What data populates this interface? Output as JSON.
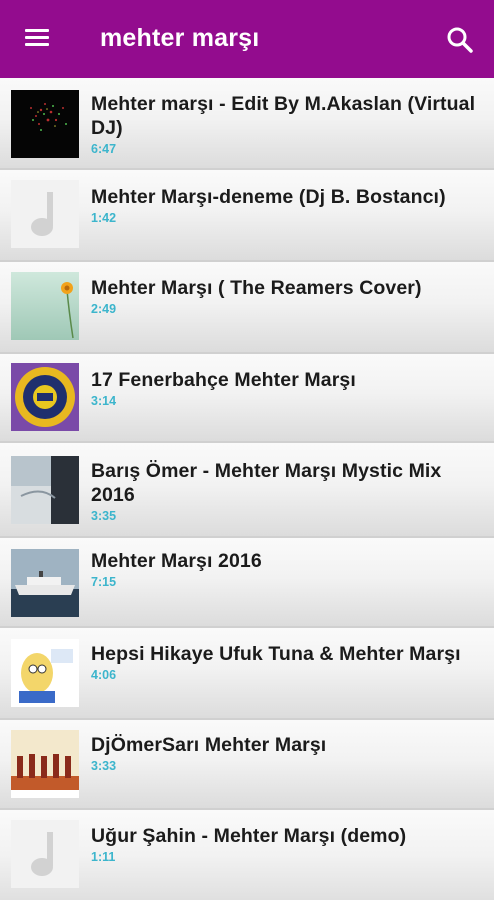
{
  "app_bar": {
    "title": "mehter marşı",
    "menu_icon": "hamburger-menu-icon",
    "search_icon": "search-icon",
    "color": "#930c8e"
  },
  "accent": {
    "duration_color": "#3cb5cc"
  },
  "songs": [
    {
      "title": "Mehter marşı - Edit By M.Akaslan (Virtual DJ)",
      "duration": "6:47",
      "thumb": "fireworks-art"
    },
    {
      "title": "Mehter Marşı-deneme (Dj B. Bostancı)",
      "duration": "1:42",
      "thumb": "music-note-icon"
    },
    {
      "title": "Mehter Marşı ( The Reamers Cover)",
      "duration": "2:49",
      "thumb": "flower-art"
    },
    {
      "title": "17 Fenerbahçe Mehter Marşı",
      "duration": "3:14",
      "thumb": "emblem-art"
    },
    {
      "title": "Barış Ömer - Mehter Marşı Mystic Mix 2016",
      "duration": "3:35",
      "thumb": "album-cover-art"
    },
    {
      "title": "Mehter Marşı 2016",
      "duration": "7:15",
      "thumb": "ship-sea-art"
    },
    {
      "title": "Hepsi Hikaye Ufuk Tuna & Mehter Marşı",
      "duration": "4:06",
      "thumb": "cartoon-art"
    },
    {
      "title": "DjÖmerSarı Mehter Marşı",
      "duration": "3:33",
      "thumb": "mehter-band-art"
    },
    {
      "title": "Uğur Şahin - Mehter Marşı (demo)",
      "duration": "1:11",
      "thumb": "music-note-icon"
    }
  ]
}
